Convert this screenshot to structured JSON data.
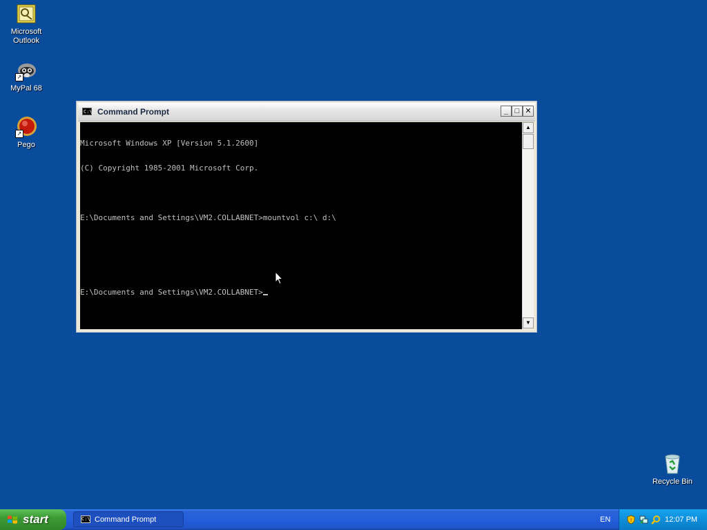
{
  "desktop": {
    "icons": [
      {
        "label_line1": "Microsoft",
        "label_line2": "Outlook",
        "icon": "outlook-icon"
      },
      {
        "label_line1": "MyPal 68",
        "icon": "mypal-icon"
      },
      {
        "label_line1": "Pego",
        "icon": "pego-icon"
      },
      {
        "label_line1": "Recycle Bin",
        "icon": "recycle-bin-icon"
      }
    ]
  },
  "window": {
    "title": "Command Prompt",
    "icon_text": "C:\\",
    "buttons": {
      "minimize": "_",
      "maximize": "□",
      "close": "✕"
    },
    "console_lines": [
      "Microsoft Windows XP [Version 5.1.2600]",
      "(C) Copyright 1985-2001 Microsoft Corp.",
      "",
      "E:\\Documents and Settings\\VM2.COLLABNET>mountvol c:\\ d:\\",
      "",
      "",
      "E:\\Documents and Settings\\VM2.COLLABNET>"
    ]
  },
  "taskbar": {
    "start_label": "start",
    "task_button_label": "Command Prompt",
    "language": "EN",
    "clock": "12:07 PM",
    "tray_icons": [
      "security-shield-icon",
      "network-icon",
      "search-icon"
    ]
  },
  "colors": {
    "desktop_bg": "#0a4c9c",
    "console_bg": "#000000",
    "console_text": "#c0c0c0"
  }
}
